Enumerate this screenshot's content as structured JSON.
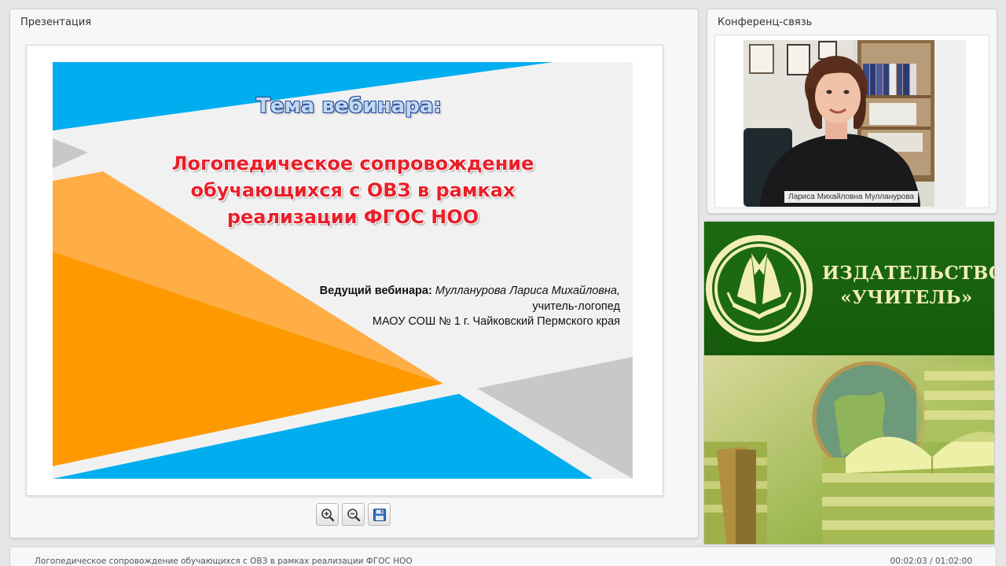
{
  "presentation": {
    "panel_title": "Презентация",
    "slide": {
      "heading": "Тема вебинара:",
      "title_lines": [
        "Логопедическое сопровождение",
        "обучающихся с ОВЗ в рамках",
        "реализации ФГОС НОО"
      ],
      "presenter_label": "Ведущий вебинара:",
      "presenter_name": "Мулланурова Лариса Михайловна",
      "presenter_name_suffix": ",",
      "presenter_role": "учитель-логопед",
      "presenter_org": "МАОУ СОШ № 1 г. Чайковский Пермского края"
    },
    "toolbar": {
      "zoom_in_icon": "zoom-in-icon",
      "zoom_out_icon": "zoom-out-icon",
      "save_icon": "save-icon"
    }
  },
  "conference": {
    "panel_title": "Конференц-связь",
    "speaker_name": "Лариса Михайловна Мулланурова"
  },
  "banner": {
    "line1": "ИЗДАТЕЛЬСТВО",
    "line2": "«УЧИТЕЛЬ»",
    "logo_icon": "book-logo-icon"
  },
  "status": {
    "title": "Логопедическое сопровождение обучающихся с ОВЗ в рамках реализации ФГОС НОО",
    "time": "00:02:03 / 01:02:00"
  },
  "colors": {
    "slide_blue": "#00aeef",
    "slide_orange": "#ff9900",
    "slide_light_orange": "#ffad45",
    "slide_gray": "#c8c8c8",
    "title_red": "#e8202a",
    "banner_green": "#1e6b12"
  }
}
